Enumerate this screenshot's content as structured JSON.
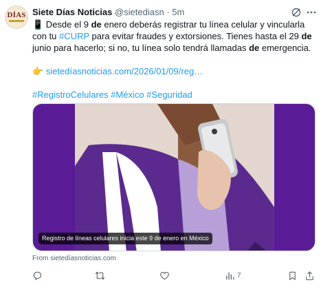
{
  "author": {
    "name": "Siete Días Noticias",
    "handle": "@sietediasn",
    "separator": "·",
    "time": "5m",
    "avatar_text": "DÍAS"
  },
  "tweet": {
    "phone_emoji": "📱",
    "p1_a": " Desde el 9 ",
    "p1_b": "de",
    "p1_c": " enero deberás registrar tu línea celular y vincularla con tu ",
    "curp": "#CURP",
    "p1_d": " para evitar fraudes y extorsiones. Tienes hasta el 29 ",
    "p1_e": "de",
    "p1_f": " junio para hacerlo; si no, tu línea solo tendrá llamadas ",
    "p1_g": "de",
    "p1_h": " emergencia.",
    "pointer_emoji": "👉",
    "link": "sietedíasnoticias.com/2026/01/09/reg…",
    "hashtags": "#RegistroCelulares #México #Seguridad"
  },
  "card": {
    "caption": "Registro de líneas celulares inicia este 9 de enero en México",
    "source": "From sietedíasnoticias.com"
  },
  "actions": {
    "views_count": "7"
  },
  "colors": {
    "accent": "#1d9bf0",
    "card_bg": "#5a1c96",
    "muted": "#536471"
  }
}
